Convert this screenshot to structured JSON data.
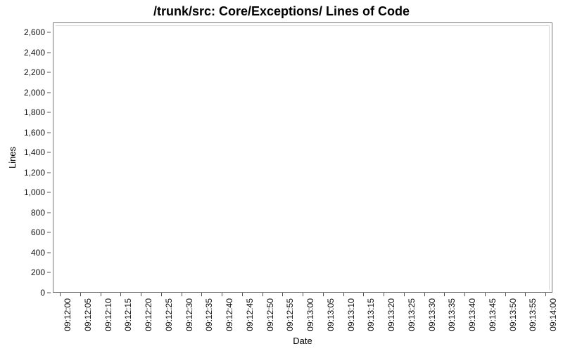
{
  "chart_data": {
    "type": "line",
    "title": "/trunk/src: Core/Exceptions/ Lines of Code",
    "xlabel": "Date",
    "ylabel": "Lines",
    "categories": [
      "09:12:00",
      "09:12:05",
      "09:12:10",
      "09:12:15",
      "09:12:20",
      "09:12:25",
      "09:12:30",
      "09:12:35",
      "09:12:40",
      "09:12:45",
      "09:12:50",
      "09:12:55",
      "09:13:00",
      "09:13:05",
      "09:13:10",
      "09:13:15",
      "09:13:20",
      "09:13:25",
      "09:13:30",
      "09:13:35",
      "09:13:40",
      "09:13:45",
      "09:13:50",
      "09:13:55",
      "09:14:00"
    ],
    "series": [
      {
        "name": "Lines of Code",
        "values": []
      }
    ],
    "ylim": [
      0,
      2700
    ],
    "y_ticks": [
      0,
      200,
      400,
      600,
      800,
      1000,
      1200,
      1400,
      1600,
      1800,
      2000,
      2200,
      2400,
      2600
    ],
    "grid": false
  }
}
